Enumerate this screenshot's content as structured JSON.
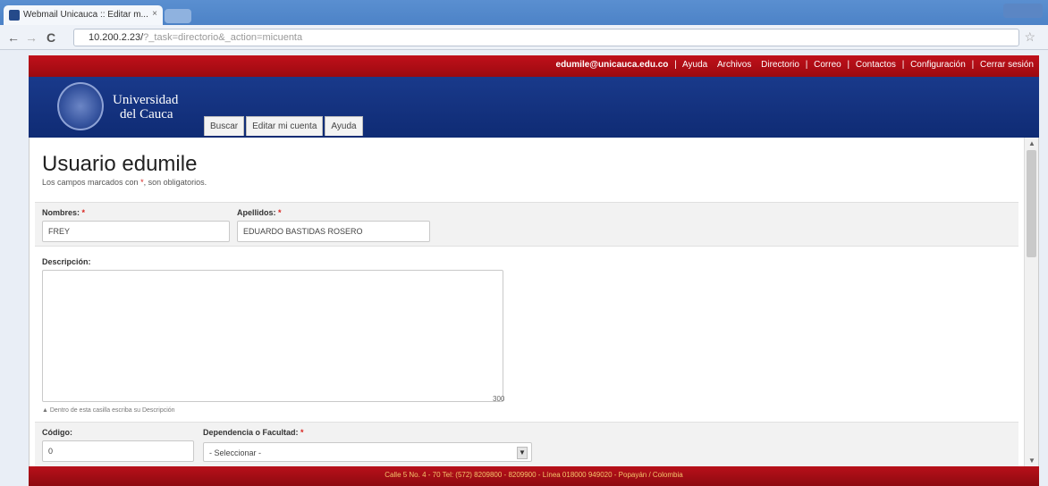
{
  "browser": {
    "tab_title": "Webmail Unicauca :: Editar m...",
    "tab_close": "×",
    "url_host": "10.200.2.23/",
    "url_path": "?_task=directorio&_action=micuenta",
    "back_icon": "←",
    "forward_icon": "→",
    "reload_icon": "C",
    "star_icon": "☆"
  },
  "topnav": {
    "email": "edumile@unicauca.edu.co",
    "items": [
      "Ayuda",
      "Archivos",
      "Directorio",
      "Correo",
      "Contactos",
      "Configuración",
      "Cerrar sesión"
    ],
    "separator": "|"
  },
  "brand": {
    "name_line1": "Universidad",
    "name_line2": "del Cauca"
  },
  "site_tabs": [
    "Buscar",
    "Editar mi cuenta",
    "Ayuda"
  ],
  "page": {
    "title": "Usuario edumile",
    "note_prefix": "Los campos marcados con",
    "note_star": "*",
    "note_suffix": ", son obligatorios."
  },
  "form": {
    "required_mark": "*",
    "nombres_label": "Nombres:",
    "nombres_value": "FREY",
    "apellidos_label": "Apellidos:",
    "apellidos_value": "EDUARDO BASTIDAS ROSERO",
    "descripcion_label": "Descripción:",
    "descripcion_counter": "300",
    "descripcion_hint": "▲ Dentro de esta casilla escriba su Descripción",
    "codigo_label": "Código:",
    "codigo_value": "0",
    "dependencia_label": "Dependencia o Facultad:",
    "dependencia_value": "- Seleccionar -"
  },
  "footer": {
    "text": "Calle 5 No. 4 - 70 Tel: (572) 8209800 - 8209900 - Línea 018000 949020 - Popayán / Colombia"
  },
  "colors": {
    "header_red": "#b0101a",
    "header_blue": "#163783",
    "required": "#d9231f"
  }
}
